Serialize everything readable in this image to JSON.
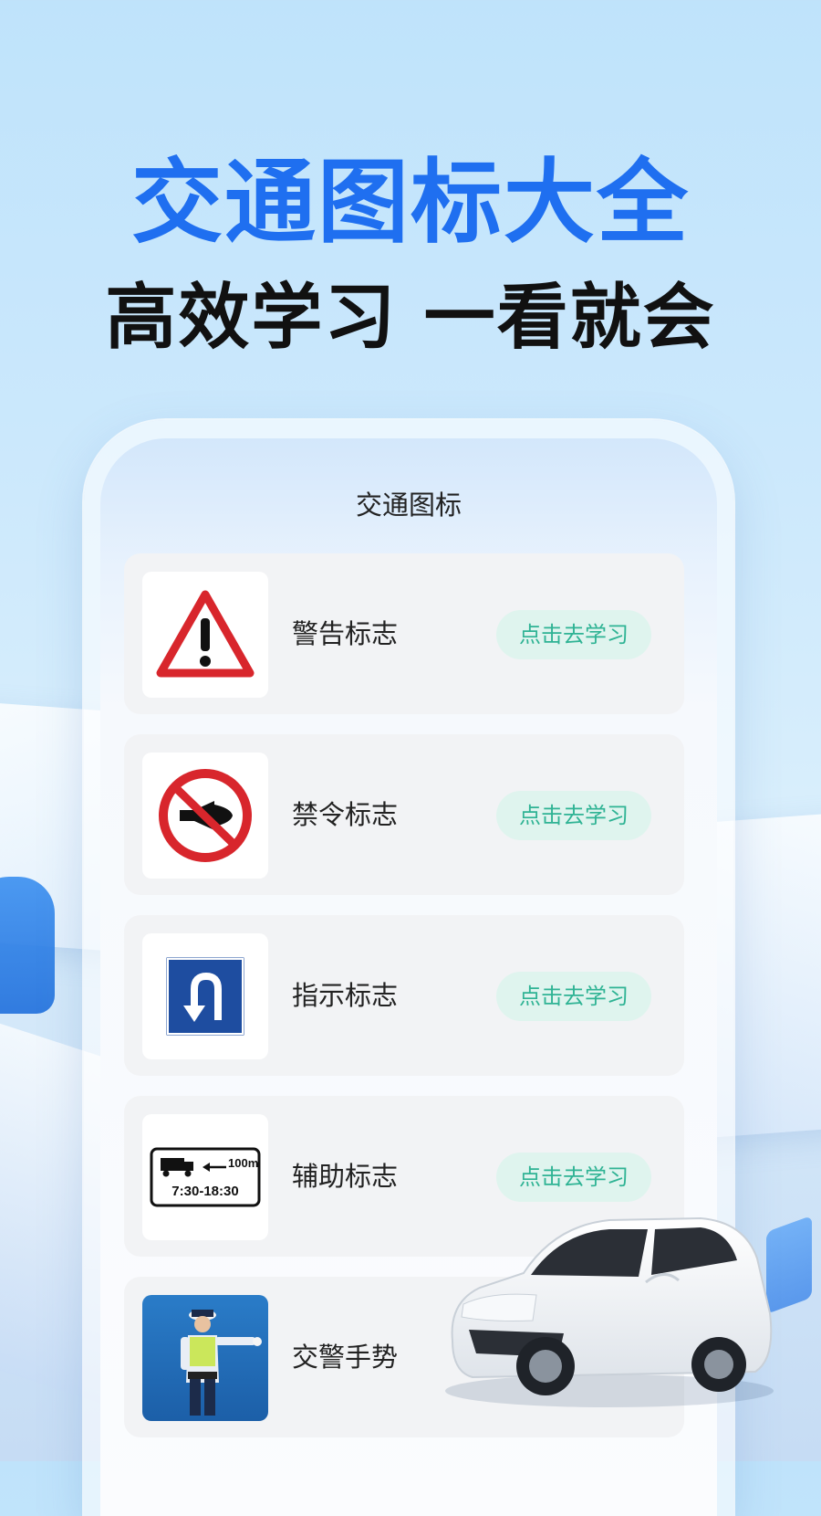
{
  "hero": {
    "title": "交通图标大全",
    "subtitle": "高效学习 一看就会"
  },
  "screen": {
    "title": "交通图标"
  },
  "items": [
    {
      "label": "警告标志",
      "button": "点击去学习",
      "icon": "warning-triangle-icon"
    },
    {
      "label": "禁令标志",
      "button": "点击去学习",
      "icon": "no-horn-icon"
    },
    {
      "label": "指示标志",
      "button": "点击去学习",
      "icon": "u-turn-icon"
    },
    {
      "label": "辅助标志",
      "button": "点击去学习",
      "icon": "truck-time-sign-icon",
      "sign_distance": "100m",
      "sign_time": "7:30-18:30"
    },
    {
      "label": "交警手势",
      "icon": "traffic-police-photo"
    }
  ],
  "colors": {
    "title_blue": "#1f6ff0",
    "button_bg": "#dff4ee",
    "button_text": "#2fb394"
  }
}
